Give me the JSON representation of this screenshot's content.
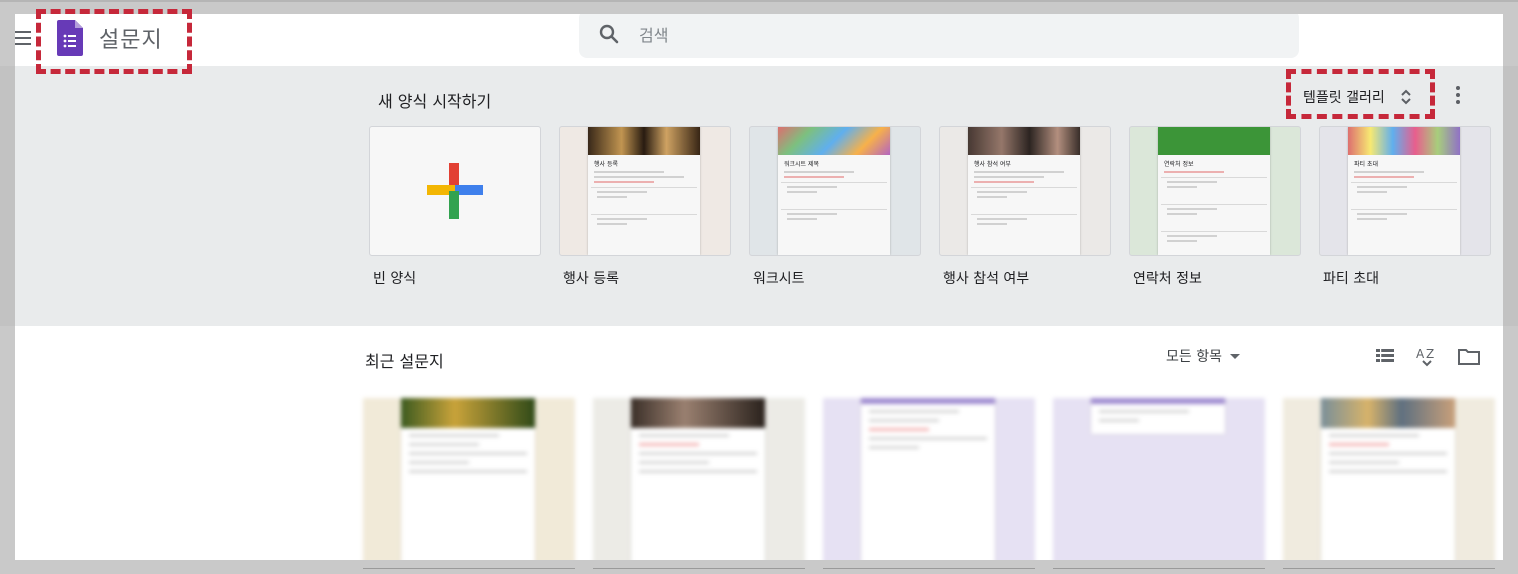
{
  "app": {
    "title": "설문지"
  },
  "search": {
    "placeholder": "검색"
  },
  "templates": {
    "heading": "새 양식 시작하기",
    "gallery_label": "템플릿 갤러리",
    "items": [
      {
        "label": "빈 양식"
      },
      {
        "label": "행사 등록",
        "form_title": "행사 등록"
      },
      {
        "label": "워크시트",
        "form_title": "워크시트 제목"
      },
      {
        "label": "행사 참석 여부",
        "form_title": "행사 참석 여부"
      },
      {
        "label": "연락처 정보",
        "form_title": "연락처 정보"
      },
      {
        "label": "파티 초대",
        "form_title": "파티 초대"
      }
    ]
  },
  "recent": {
    "heading": "최근 설문지",
    "filter_label": "모든 항목"
  },
  "colors": {
    "forms_purple": "#673ab7",
    "highlight_red": "#c6283a",
    "band_gray": "#f1f3f4",
    "plus_red": "#ea4335",
    "plus_blue": "#4285f4",
    "plus_yellow": "#fbbc04",
    "plus_green": "#34a853"
  },
  "icons": [
    "menu-icon",
    "forms-logo-icon",
    "search-icon",
    "unfold-icon",
    "more-vert-icon",
    "plus-icon",
    "list-view-icon",
    "sort-az-icon",
    "folder-icon"
  ]
}
